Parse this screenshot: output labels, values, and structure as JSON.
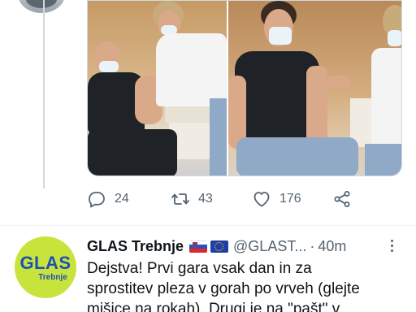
{
  "previous_tweet": {
    "stats": {
      "replies": "24",
      "retweets": "43",
      "likes": "176"
    },
    "icons": {
      "reply": "reply-icon",
      "retweet": "retweet-icon",
      "like": "heart-icon",
      "share": "share-icon"
    }
  },
  "tweet": {
    "author_name": "GLAS Trebnje",
    "handle": "@GLAST...",
    "separator": "·",
    "time": "40m",
    "avatar_text": "GLAS",
    "avatar_subtext": "Trebnje",
    "flags": [
      "slovenia-flag-icon",
      "eu-flag-icon"
    ],
    "text_lines": [
      "Dejstva! Prvi gara vsak dan in za",
      "sprostitev pleza v gorah po vrveh (glejte",
      "mišice na rokah). Drugi je na \"pašt\" v"
    ]
  },
  "colors": {
    "muted": "#536471",
    "avatar_bg": "#c8e43c",
    "avatar_text": "#1d4fb8",
    "thread_line": "#cfd9de"
  }
}
